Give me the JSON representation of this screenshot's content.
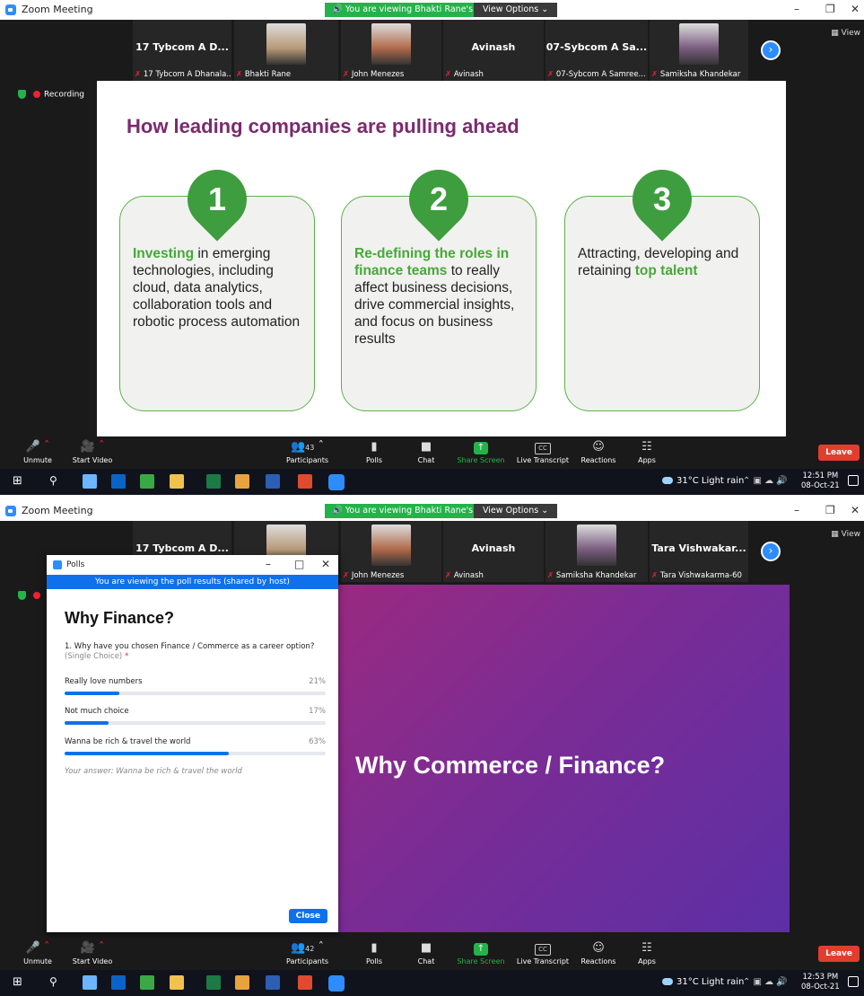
{
  "colors": {
    "zoom_blue": "#2D8CFF",
    "share_green": "#23b34a",
    "leave_red": "#e03e2f",
    "slide_title_purple": "#7b2a6e",
    "card_green": "#3e9d3e"
  },
  "screens": [
    {
      "window_title": "Zoom Meeting",
      "share_banner": "You are viewing Bhakti Rane's screen",
      "view_options": "View Options",
      "view_button": "View",
      "tiles": [
        {
          "big": "17 Tybcom A D...",
          "caption": "17 Tybcom A Dhanala...",
          "video": false
        },
        {
          "big": "",
          "caption": "Bhakti Rane",
          "video": true
        },
        {
          "big": "",
          "caption": "John Menezes",
          "video": true
        },
        {
          "big": "Avinash",
          "caption": "Avinash",
          "video": false
        },
        {
          "big": "07-Sybcom A Sa...",
          "caption": "07-Sybcom A Samree...",
          "video": false
        },
        {
          "big": "",
          "caption": "Samiksha Khandekar",
          "video": true
        }
      ],
      "recording": "Recording",
      "slide": {
        "title": "How leading companies are pulling ahead",
        "cards": [
          {
            "num": "1",
            "hl": "Investing",
            "rest": " in emerging technologies, including cloud, data analytics, collaboration tools and robotic process automation"
          },
          {
            "num": "2",
            "hl": "Re-defining the roles in finance teams",
            "rest": " to really affect business decisions, drive commercial insights, and focus on business results"
          },
          {
            "num": "3",
            "pre": "Attracting, developing and retaining ",
            "hl": "top talent"
          }
        ]
      },
      "toolbar": {
        "unmute": "Unmute",
        "start_video": "Start Video",
        "participants": "Participants",
        "participants_count": "43",
        "polls": "Polls",
        "chat": "Chat",
        "share_screen": "Share Screen",
        "live_transcript": "Live Transcript",
        "reactions": "Reactions",
        "apps": "Apps",
        "leave": "Leave"
      },
      "taskbar": {
        "weather": "31°C Light rain",
        "time": "12:51 PM",
        "date": "08-Oct-21"
      }
    },
    {
      "window_title": "Zoom Meeting",
      "share_banner": "You are viewing Bhakti Rane's screen",
      "view_options": "View Options",
      "view_button": "View",
      "tiles": [
        {
          "big": "17 Tybcom A D...",
          "caption": "",
          "video": false
        },
        {
          "big": "",
          "caption": "",
          "video": true
        },
        {
          "big": "",
          "caption": "John Menezes",
          "video": true
        },
        {
          "big": "Avinash",
          "caption": "Avinash",
          "video": false
        },
        {
          "big": "",
          "caption": "Samiksha Khandekar",
          "video": true
        },
        {
          "big": "Tara Vishwakar...",
          "caption": "Tara Vishwakarma-60",
          "video": false
        }
      ],
      "poll": {
        "window_title": "Polls",
        "banner": "You are viewing the poll results (shared by host)",
        "title": "Why Finance?",
        "question": "1. Why have you chosen Finance / Commerce as a career option?",
        "question_type": "(Single Choice)",
        "required": "*",
        "options": [
          {
            "label": "Really love numbers",
            "pct": "21%",
            "value": 21
          },
          {
            "label": "Not much choice",
            "pct": "17%",
            "value": 17
          },
          {
            "label": "Wanna be rich & travel the world",
            "pct": "63%",
            "value": 63
          }
        ],
        "answer": "Your answer: Wanna be rich & travel the world",
        "close": "Close"
      },
      "slide": {
        "title": "Why Commerce / Finance?"
      },
      "toolbar": {
        "unmute": "Unmute",
        "start_video": "Start Video",
        "participants": "Participants",
        "participants_count": "42",
        "polls": "Polls",
        "chat": "Chat",
        "share_screen": "Share Screen",
        "live_transcript": "Live Transcript",
        "reactions": "Reactions",
        "apps": "Apps",
        "leave": "Leave"
      },
      "taskbar": {
        "weather": "31°C Light rain",
        "time": "12:53 PM",
        "date": "08-Oct-21"
      }
    }
  ]
}
